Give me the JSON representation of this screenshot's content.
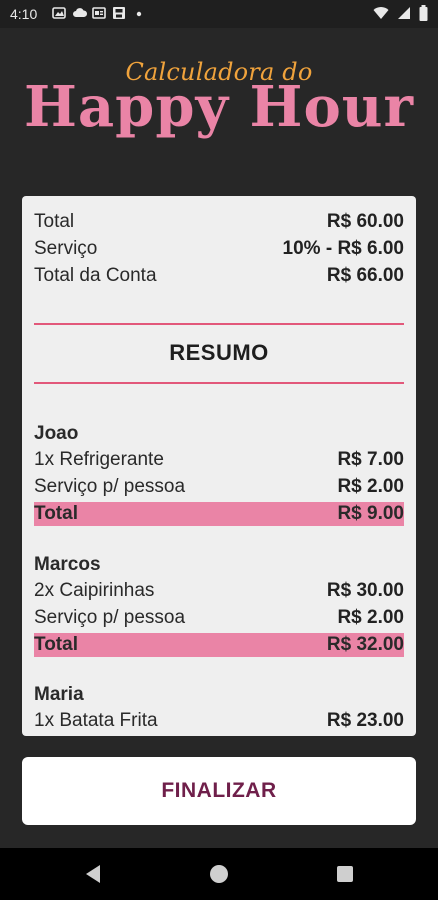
{
  "status_bar": {
    "time": "4:10",
    "icons_left": [
      "gallery-icon",
      "cloud-icon",
      "news-icon",
      "save-icon",
      "dot-icon"
    ],
    "icons_right": [
      "wifi-icon",
      "signal-icon",
      "battery-icon"
    ]
  },
  "header": {
    "subtitle": "Calculadora do",
    "title": "Happy Hour"
  },
  "summary": {
    "total_label": "Total",
    "total_value": "R$ 60.00",
    "service_label": "Serviço",
    "service_value": "10% - R$ 6.00",
    "bill_label": "Total da Conta",
    "bill_value": "R$ 66.00"
  },
  "resumo_title": "RESUMO",
  "people": [
    {
      "name": "Joao",
      "items": [
        {
          "label": "1x Refrigerante",
          "value": "R$ 7.00"
        },
        {
          "label": "Serviço p/ pessoa",
          "value": "R$ 2.00"
        }
      ],
      "total_label": "Total",
      "total_value": "R$ 9.00"
    },
    {
      "name": "Marcos",
      "items": [
        {
          "label": "2x Caipirinhas",
          "value": "R$ 30.00"
        },
        {
          "label": "Serviço p/ pessoa",
          "value": "R$ 2.00"
        }
      ],
      "total_label": "Total",
      "total_value": "R$ 32.00"
    },
    {
      "name": "Maria",
      "items": [
        {
          "label": "1x Batata Frita",
          "value": "R$ 23.00"
        }
      ]
    }
  ],
  "finalize_button": "FINALIZAR",
  "colors": {
    "background": "#272727",
    "accent_pink": "#ea84a6",
    "accent_orange": "#f0a33c",
    "divider": "#e2587a",
    "button_text": "#6f1f4a"
  },
  "nav_bar": {
    "icons": [
      "back-icon",
      "home-icon",
      "recents-icon"
    ]
  }
}
